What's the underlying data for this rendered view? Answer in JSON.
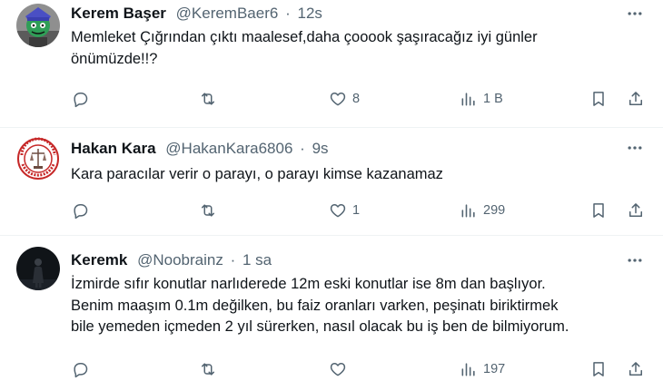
{
  "tweets": [
    {
      "name": "Kerem Başer",
      "handle": "@KeremBaer6",
      "time": "12s",
      "text_lines": [
        "Memleket Çığrından çıktı maalesef,daha çooook şaşıracağız iyi günler",
        "önümüzde!!?"
      ],
      "likes": "8",
      "views": "1 B"
    },
    {
      "name": "Hakan Kara",
      "handle": "@HakanKara6806",
      "time": "9s",
      "text_lines": [
        "Kara paracılar verir o parayı, o parayı kimse kazanamaz"
      ],
      "likes": "1",
      "views": "299"
    },
    {
      "name": "Keremk",
      "handle": "@Noobrainz",
      "time": "1 sa",
      "text_lines": [
        "İzmirde sıfır konutlar narlıderede 12m eski konutlar ise 8m dan başlıyor.",
        "Benim maaşım 0.1m değilken, bu faiz oranları varken, peşinatı biriktirmek",
        "bile yemeden içmeden 2 yıl sürerken, nasıl olacak bu iş ben de bilmiyorum."
      ],
      "likes": "",
      "views": "197"
    }
  ],
  "separator": "·",
  "icons": {
    "more": "more-horizontal-icon",
    "reply": "reply-icon",
    "retweet": "retweet-icon",
    "like": "heart-icon",
    "views": "views-icon",
    "bookmark": "bookmark-icon",
    "share": "share-icon"
  },
  "colors": {
    "text": "#0f1419",
    "secondary": "#536471",
    "divider": "#eff3f4",
    "background": "#ffffff"
  }
}
